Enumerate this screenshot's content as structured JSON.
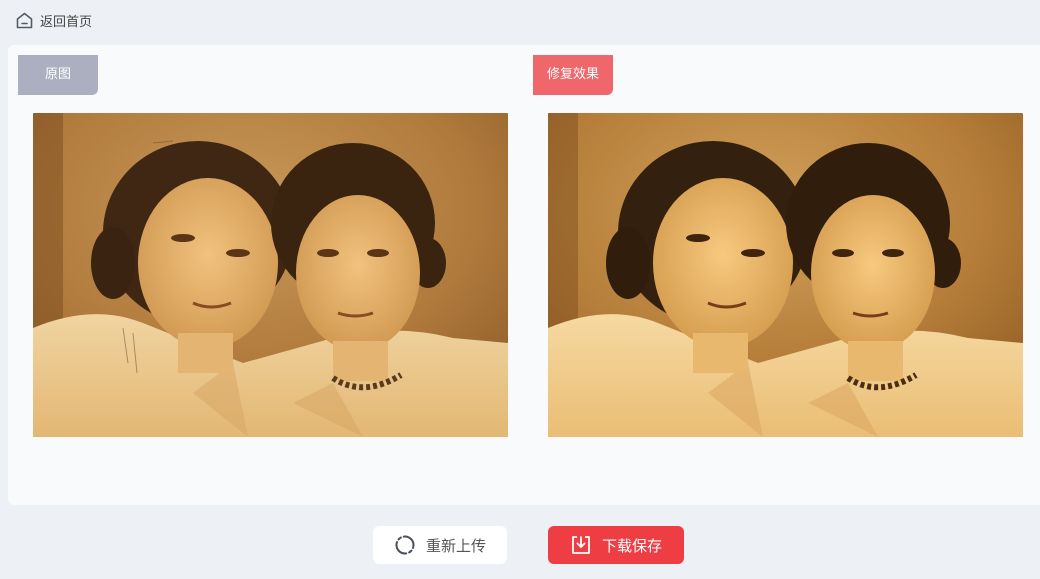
{
  "header": {
    "back_label": "返回首页",
    "back_icon": "home-icon"
  },
  "compare": {
    "original_tag": "原图",
    "repaired_tag": "修复效果",
    "original_tag_color": "#abafc0",
    "repaired_tag_color": "#f0676b"
  },
  "actions": {
    "reupload_label": "重新上传",
    "reupload_icon": "refresh-icon",
    "download_label": "下载保存",
    "download_icon": "download-icon",
    "download_color": "#ee3d43"
  }
}
